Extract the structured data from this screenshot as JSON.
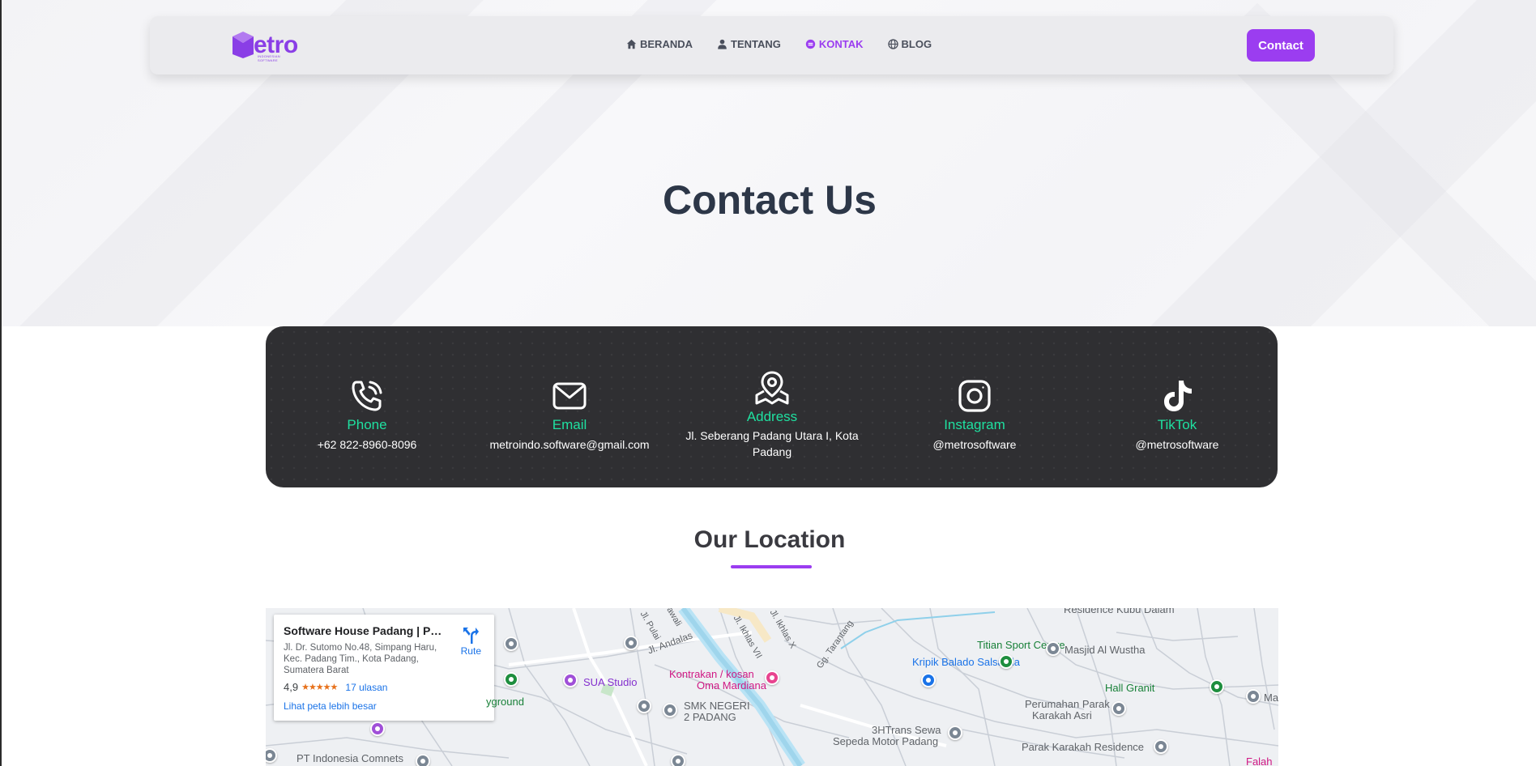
{
  "navbar": {
    "logo_text": "etro",
    "logo_subtext": "INDONESIAN SOFTWARE",
    "menu": [
      {
        "label": "BERANDA",
        "icon": "home-icon",
        "active": false
      },
      {
        "label": "TENTANG",
        "icon": "user-icon",
        "active": false
      },
      {
        "label": "KONTAK",
        "icon": "contact-icon",
        "active": true
      },
      {
        "label": "BLOG",
        "icon": "globe-icon",
        "active": false
      }
    ],
    "contact_button": "Contact"
  },
  "hero": {
    "title": "Contact Us"
  },
  "contacts": [
    {
      "label": "Phone",
      "value": "+62 822-8960-8096",
      "icon": "phone-icon"
    },
    {
      "label": "Email",
      "value": "metroindo.software@gmail.com",
      "icon": "mail-icon"
    },
    {
      "label": "Address",
      "value": "Jl. Seberang Padang Utara I, Kota Padang",
      "icon": "location-pin-icon"
    },
    {
      "label": "Instagram",
      "value": "@metrosoftware",
      "icon": "instagram-icon"
    },
    {
      "label": "TikTok",
      "value": "@metrosoftware",
      "icon": "tiktok-icon"
    }
  ],
  "location": {
    "title": "Our Location"
  },
  "map": {
    "place_card": {
      "name": "Software House Padang | PT. ...",
      "address": "Jl. Dr. Sutomo No.48, Simpang Haru, Kec. Padang Tim., Kota Padang, Sumatera Barat",
      "rating": "4,9",
      "stars": "★★★★★",
      "reviews": "17 ulasan",
      "route_label": "Rute",
      "larger_map": "Lihat peta lebih besar"
    },
    "labels": {
      "sua_studio": "SUA Studio",
      "kontrakan": "Kontrakan / kosan",
      "kontrakan2": "Oma Mardiana",
      "smk": "SMK NEGERI",
      "smk2": "2 PADANG",
      "kripik": "Kripik Balado Salsabila",
      "titian": "Titian Sport Centre",
      "masjid": "Masjid Al Wustha",
      "hall": "Hall Granit",
      "perumahan": "Perumahan Parak",
      "perumahan2": "Karakah Asri",
      "trans": "3HTrans Sewa",
      "trans2": "Sepeda Motor Padang",
      "parak_residence": "Parak Karakah Residence",
      "kubu": "Residence Kubu Dalam",
      "comnets": "PT Indonesia Comnets",
      "playground": "yground",
      "andalas": "Jl. Andalas",
      "pulai": "Jl. Pulai",
      "jawali": "Jawali",
      "ikhlas7": "Jl. Ikhlas VII",
      "ikhlas10": "Jl. Ikhlas X",
      "tarantang": "Gg. Tarantang",
      "ma": "Ma",
      "falah": "Falah"
    }
  },
  "colors": {
    "accent": "#9b3df0",
    "contact_label": "#1fe0a0",
    "panel_bg": "#2f2f32",
    "title": "#2d3748"
  }
}
